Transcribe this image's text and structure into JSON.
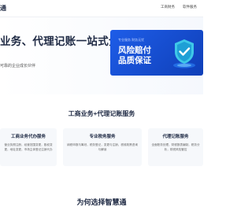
{
  "header": {
    "logo_char": "通",
    "nav": [
      "工商财务",
      "软件服务"
    ]
  },
  "hero": {
    "title": "业务、代理记账一站式企业",
    "subtitle": "可靠的企业成长伙伴"
  },
  "banner": {
    "tags": "专业服务    财务无忧",
    "line1": "风险赔付",
    "line2": "品质保证"
  },
  "services": {
    "title": "工商业务+代理记账服务",
    "cards": [
      {
        "title": "工商业务代办服务",
        "text": "营业执照注册，经营范围变更，股权变更，地址变更，市场主体登记注销代办"
      },
      {
        "title": "专业税务服务",
        "text": "纳税申报与筹划，税务登记，变更与注销，税收政策咨询与解读"
      },
      {
        "title": "代理记账服务",
        "text": "全面账务处理，财税报表编制，税务分析，财税风险管控"
      }
    ]
  },
  "bottom": {
    "title": "为何选择智慧通"
  },
  "colors": {
    "accent": "#1e5de8",
    "text_dark": "#1f2a44",
    "card_bg": "#f6f8fb"
  }
}
